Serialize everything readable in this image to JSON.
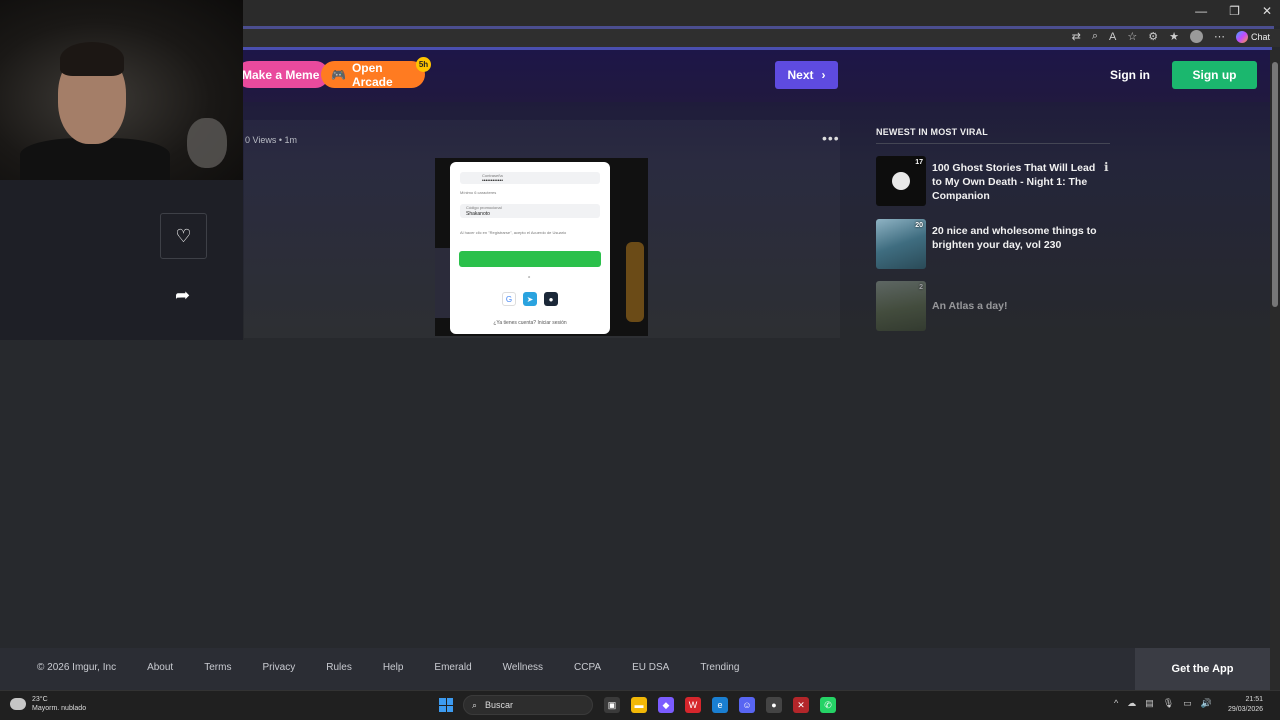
{
  "browser": {
    "chat_label": "Chat",
    "window_controls": [
      "—",
      "❐",
      "✕"
    ]
  },
  "header": {
    "make_meme": "Make a Meme",
    "open_arcade": "Open Arcade",
    "arcade_badge": "5h",
    "next": "Next",
    "sign_in": "Sign in",
    "sign_up": "Sign up"
  },
  "post": {
    "meta": "0 Views • 1m",
    "more": "•••",
    "image": {
      "field1_label": "Contraseña",
      "field1_value": "••••••••••••",
      "hint": "Mínimo 6 caracteres",
      "field2_label": "Código promocional",
      "field2_value": "Shakanoto",
      "terms": "Al hacer clic en \"Registrarse\", acepto el Acuerdo de Usuario",
      "or": "o",
      "login_prompt": "¿Ya tienes cuenta? Iniciar sesión"
    }
  },
  "sidebar": {
    "title": "NEWEST IN MOST VIRAL",
    "items": [
      {
        "count": "17",
        "title": "100 Ghost Stories That Will Lead to My Own Death - Night 1: The Companion"
      },
      {
        "count": "20",
        "title": "20 nice and wholesome things to brighten your day, vol 230"
      },
      {
        "count": "2",
        "title": "An Atlas a day!"
      }
    ]
  },
  "footer": {
    "copyright": "© 2026 Imgur, Inc",
    "links": [
      "About",
      "Terms",
      "Privacy",
      "Rules",
      "Help",
      "Emerald",
      "Wellness",
      "CCPA",
      "EU DSA",
      "Trending"
    ],
    "get_app": "Get the App"
  },
  "taskbar": {
    "weather_temp": "23°C",
    "weather_desc": "Mayorm. nublado",
    "search_placeholder": "Buscar",
    "time": "21:51",
    "date": "29/03/2026"
  }
}
